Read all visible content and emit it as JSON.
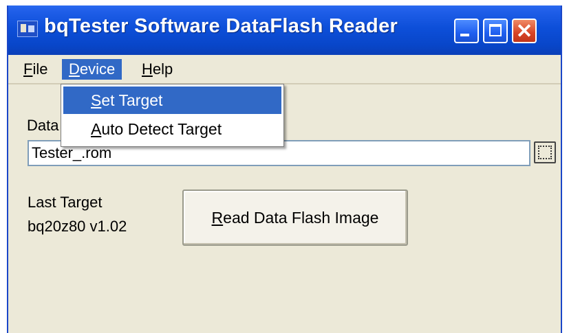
{
  "window": {
    "title": "bqTester Software DataFlash Reader",
    "icon": "application-icon",
    "controls": [
      "minimize-icon",
      "maximize-icon",
      "close-icon"
    ],
    "close_glyph": "✕"
  },
  "menubar": {
    "items": [
      {
        "accel": "F",
        "rest": "ile"
      },
      {
        "accel": "D",
        "rest": "evice"
      },
      {
        "accel": "H",
        "rest": "elp"
      }
    ],
    "open_menu": "Device",
    "dropdown": [
      {
        "accel": "S",
        "rest": "et Target",
        "highlighted": true
      },
      {
        "accel": "A",
        "rest": "uto Detect Target",
        "highlighted": false
      }
    ]
  },
  "main": {
    "data_label_visible": "Data",
    "file_value": "Tester_.rom",
    "browse_icon": "browse-icon",
    "last_target_label": "Last Target",
    "last_target_value": "bq20z80 v1.02",
    "read_button": {
      "accel": "R",
      "rest": "ead Data Flash Image"
    }
  },
  "colors": {
    "titlebar": "#0a4bd4",
    "menu_highlight": "#3169c6",
    "window_bg": "#ece9d8",
    "close_button": "#d74426"
  }
}
